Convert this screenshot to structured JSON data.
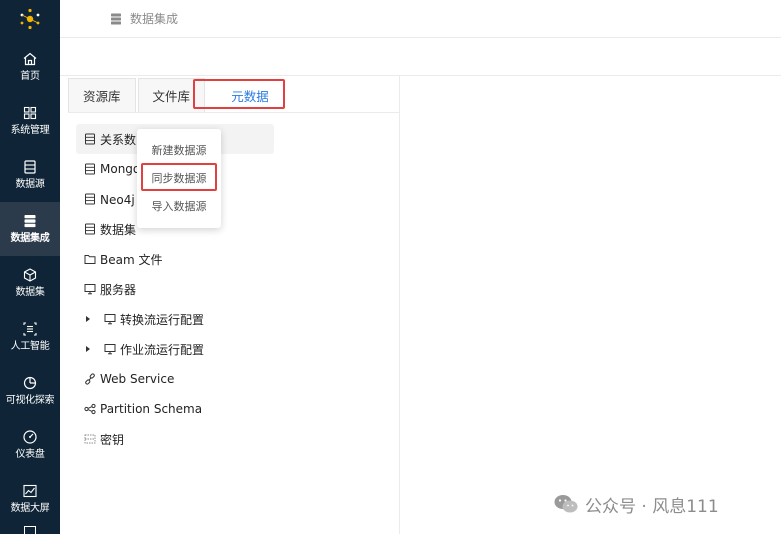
{
  "header": {
    "title": "数据集成"
  },
  "sidebar": {
    "items": [
      {
        "label": "首页",
        "icon": "home-icon"
      },
      {
        "label": "系统管理",
        "icon": "grid-icon"
      },
      {
        "label": "数据源",
        "icon": "database-icon"
      },
      {
        "label": "数据集成",
        "icon": "server-icon",
        "active": true
      },
      {
        "label": "数据集",
        "icon": "cube-icon"
      },
      {
        "label": "人工智能",
        "icon": "ai-icon"
      },
      {
        "label": "可视化探索",
        "icon": "pie-chart-icon"
      },
      {
        "label": "仪表盘",
        "icon": "gauge-icon"
      },
      {
        "label": "数据大屏",
        "icon": "line-chart-icon"
      }
    ]
  },
  "tabs": [
    {
      "label": "资源库"
    },
    {
      "label": "文件库"
    },
    {
      "label": "元数据",
      "active": true
    }
  ],
  "tree": {
    "items": [
      {
        "label": "关系数",
        "icon": "database-icon"
      },
      {
        "label": "Mongo",
        "icon": "database-icon"
      },
      {
        "label": "Neo4j 美",
        "icon": "database-icon"
      },
      {
        "label": "数据集",
        "icon": "database-icon"
      },
      {
        "label": "Beam 文件",
        "icon": "folder-icon"
      },
      {
        "label": "服务器",
        "icon": "monitor-icon"
      },
      {
        "label": "转换流运行配置",
        "icon": "monitor-icon",
        "caret": true
      },
      {
        "label": "作业流运行配置",
        "icon": "monitor-icon",
        "caret": true
      },
      {
        "label": "Web Service",
        "icon": "link-icon"
      },
      {
        "label": "Partition Schema",
        "icon": "partition-icon"
      },
      {
        "label": "密钥",
        "icon": "key-icon"
      }
    ]
  },
  "context_menu": {
    "items": [
      {
        "label": "新建数据源"
      },
      {
        "label": "同步数据源",
        "highlighted": true
      },
      {
        "label": "导入数据源"
      }
    ]
  },
  "watermark": {
    "text": "公众号 · 风息111"
  },
  "colors": {
    "sidebar_bg": "#0f2537",
    "sidebar_active": "#2b3b4b",
    "accent": "#2a7be3",
    "highlight_border": "#e0403f"
  }
}
